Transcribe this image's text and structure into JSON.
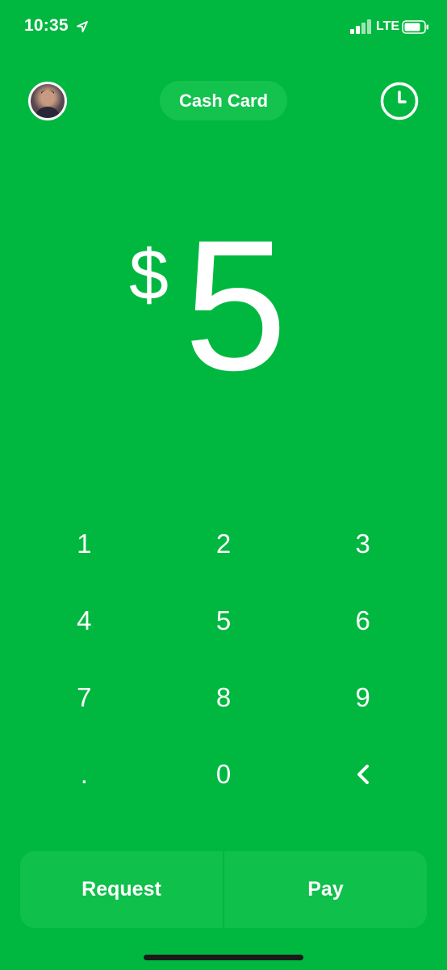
{
  "status_bar": {
    "time": "10:35",
    "network": "LTE",
    "icons": [
      "location-arrow-icon",
      "signal-bars-icon",
      "battery-icon"
    ]
  },
  "header": {
    "avatar_icon": "profile-avatar",
    "title": "Cash Card",
    "history_icon": "clock-icon"
  },
  "amount": {
    "currency": "$",
    "value": "5"
  },
  "keypad": {
    "keys": [
      "1",
      "2",
      "3",
      "4",
      "5",
      "6",
      "7",
      "8",
      "9",
      ".",
      "0"
    ],
    "backspace_icon": "chevron-left-icon"
  },
  "actions": {
    "request_label": "Request",
    "pay_label": "Pay"
  },
  "colors": {
    "background": "#00B83F",
    "button_surface": "#0FC04A",
    "text": "#FFFFFF"
  }
}
